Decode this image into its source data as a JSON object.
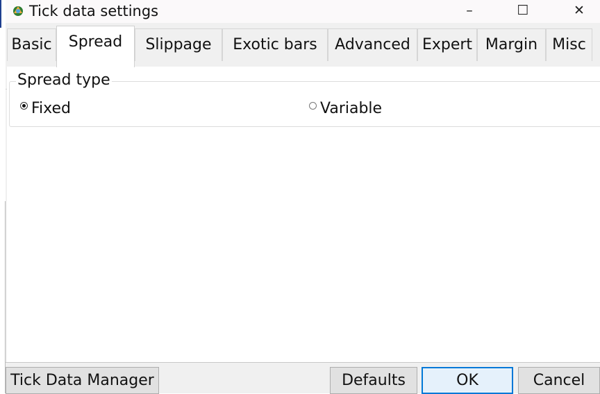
{
  "window": {
    "title": "Tick data settings",
    "controls": {
      "minimize": "–",
      "maximize": "☐",
      "close": "✕"
    }
  },
  "tabs": [
    {
      "label": "Basic",
      "active": false
    },
    {
      "label": "Spread",
      "active": true
    },
    {
      "label": "Slippage",
      "active": false
    },
    {
      "label": "Exotic bars",
      "active": false
    },
    {
      "label": "Advanced",
      "active": false
    },
    {
      "label": "Expert",
      "active": false
    },
    {
      "label": "Margin",
      "active": false
    },
    {
      "label": "Misc",
      "active": false
    }
  ],
  "spread_type": {
    "legend": "Spread type",
    "options": [
      {
        "label": "Fixed",
        "selected": true
      },
      {
        "label": "Variable",
        "selected": false
      }
    ]
  },
  "footer": {
    "manager_label": "Tick Data Manager",
    "defaults_label": "Defaults",
    "ok_label": "OK",
    "cancel_label": "Cancel"
  },
  "colors": {
    "accent": "#0078d7",
    "face": "#f0f0f0",
    "content": "#ffffff"
  },
  "icons": {
    "app": "tick-data-app-icon"
  }
}
